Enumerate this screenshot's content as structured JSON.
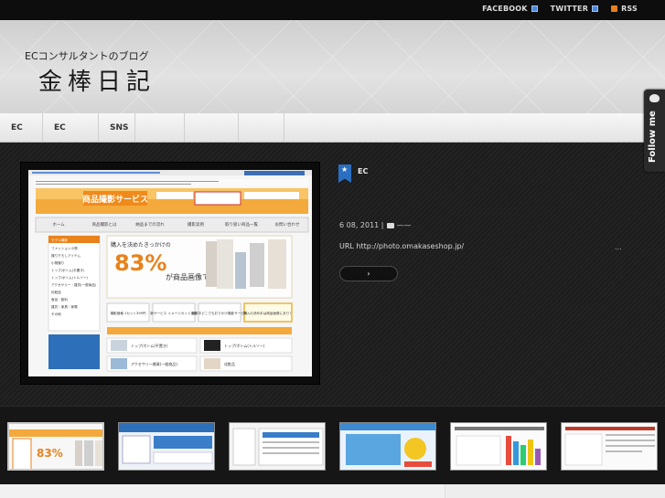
{
  "topbar": {
    "links": [
      {
        "label": "FACEBOOK",
        "icon": "external-link-icon"
      },
      {
        "label": "TWITTER",
        "icon": "external-link-icon"
      },
      {
        "label": "RSS",
        "icon": "rss-icon"
      }
    ]
  },
  "brand": {
    "subtitle": "ECコンサルタントのブログ",
    "title": "金棒日記"
  },
  "nav": {
    "items": [
      "EC",
      "EC",
      "SNS",
      "",
      "",
      ""
    ]
  },
  "follow": {
    "label": "Follow me"
  },
  "post": {
    "category": "EC",
    "date": "6 08, 2011 |",
    "comment_line": "——",
    "excerpt": "URL http://photo.omakaseshop.jp/",
    "ellipsis": "...",
    "more_label": "›"
  },
  "featured_image": {
    "headline": "商品撮影サービス",
    "percent": "83%",
    "percent_caption": "が商品画像です。",
    "banner_top": "購入を決めたきっかけの",
    "menu": [
      "ホーム",
      "商品撮影とは",
      "納品までの流れ",
      "撮影実例",
      "取り扱い商品一覧",
      "お問い合わせ"
    ],
    "buttons": [
      "撮影価格 1カット399円",
      "新サービス イメージカット撮影",
      "日本中どこでもおでかけ撮影サービス",
      "購入の決め手は商品画像にあり！"
    ],
    "side_items": [
      "モデル撮影",
      "ファッション小物",
      "撮り下ろしアイテム",
      "小物撮り",
      "トップ/ボトム(平置き)",
      "トップ/ボトム(トルソー)",
      "アクセサリー・雑貨(一般商品)",
      "化粧品",
      "食品・飲料",
      "雑貨・家具・家電",
      "その他"
    ],
    "bottom_items": [
      "トップ/ボトム(平置き)",
      "トップ/ボトム(トルソー)",
      "アクセサリー雑貨(一般商品)",
      "化粧品"
    ]
  },
  "thumbnails": [
    {
      "label": "thumb-1",
      "accent": "#f39c12"
    },
    {
      "label": "thumb-2",
      "accent": "#2d6fb8"
    },
    {
      "label": "thumb-3",
      "accent": "#3a7dc9"
    },
    {
      "label": "thumb-4",
      "accent": "#3d8ad0"
    },
    {
      "label": "thumb-5",
      "accent": "#5aa6e0"
    },
    {
      "label": "thumb-6",
      "accent": "#c0392b"
    }
  ]
}
